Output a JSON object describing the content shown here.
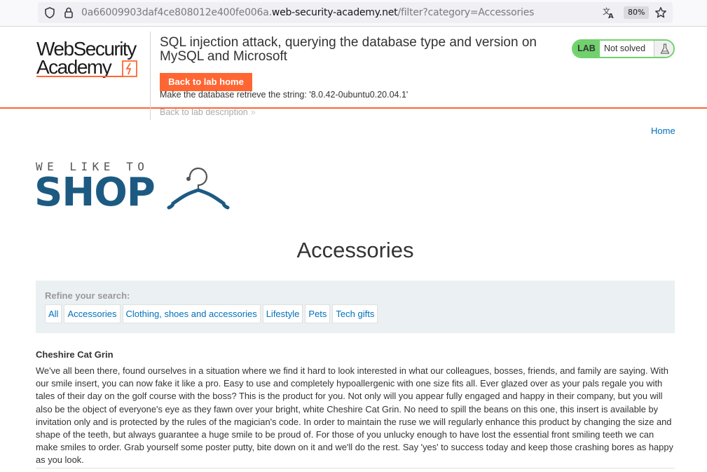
{
  "browser": {
    "url_prefix": "0a66009903daf4ce808012e400fe006a.",
    "url_domain": "web-security-academy.net",
    "url_path": "/filter?category=Accessories",
    "zoom": "80%"
  },
  "lab_header": {
    "logo_line1": "WebSecurity",
    "logo_line2": "Academy",
    "title": "SQL injection attack, querying the database type and version on MySQL and Microsoft",
    "back_button": "Back to lab home",
    "instruction": "Make the database retrieve the string: '8.0.42-0ubuntu0.20.04.1'",
    "back_description": "Back to lab description",
    "status_badge": "LAB",
    "status_text": "Not solved"
  },
  "nav": {
    "home": "Home"
  },
  "shop_logo": {
    "tagline": "WE LIKE TO",
    "name": "SHOP"
  },
  "page_title": "Accessories",
  "refine": {
    "label": "Refine your search:",
    "filters": [
      "All",
      "Accessories",
      "Clothing, shoes and accessories",
      "Lifestyle",
      "Pets",
      "Tech gifts"
    ]
  },
  "product": {
    "name": "Cheshire Cat Grin",
    "description": "We've all been there, found ourselves in a situation where we find it hard to look interested in what our colleagues, bosses, friends, and family are saying. With our smile insert, you can now fake it like a pro. Easy to use and completely hypoallergenic with one size fits all. Ever glazed over as your pals regale you with tales of their day on the golf course with the boss? This is the product for you. Not only will you appear fully engaged and happy in their company, but you will also be the object of everyone's eye as they fawn over your bright, white Cheshire Cat Grin. No need to spill the beans on this one, this insert is available by invitation only and is protected by the rules of the magician's code. In order to maintain the ruse we will regularly enhance this product by changing the size and shape of the teeth, but always guarantee a huge smile to be proud of. For those of you unlucky enough to have lost the essential front smiling teeth we can make smiles to order. Grab yourself some poster putty, bite down on it and we'll do the rest. Say 'yes' to success today and keep those crashing bores as happy as you look."
  },
  "colors": {
    "accent_orange": "#ff6633",
    "link_blue": "#0071bc",
    "shop_blue": "#1c5a82",
    "lab_green": "#70d16d",
    "refine_bg": "#ebf0f2"
  },
  "icons": [
    "shield-icon",
    "lock-icon",
    "translate-icon",
    "star-icon",
    "flask-icon",
    "hanger-icon",
    "chevron-right-icon"
  ]
}
